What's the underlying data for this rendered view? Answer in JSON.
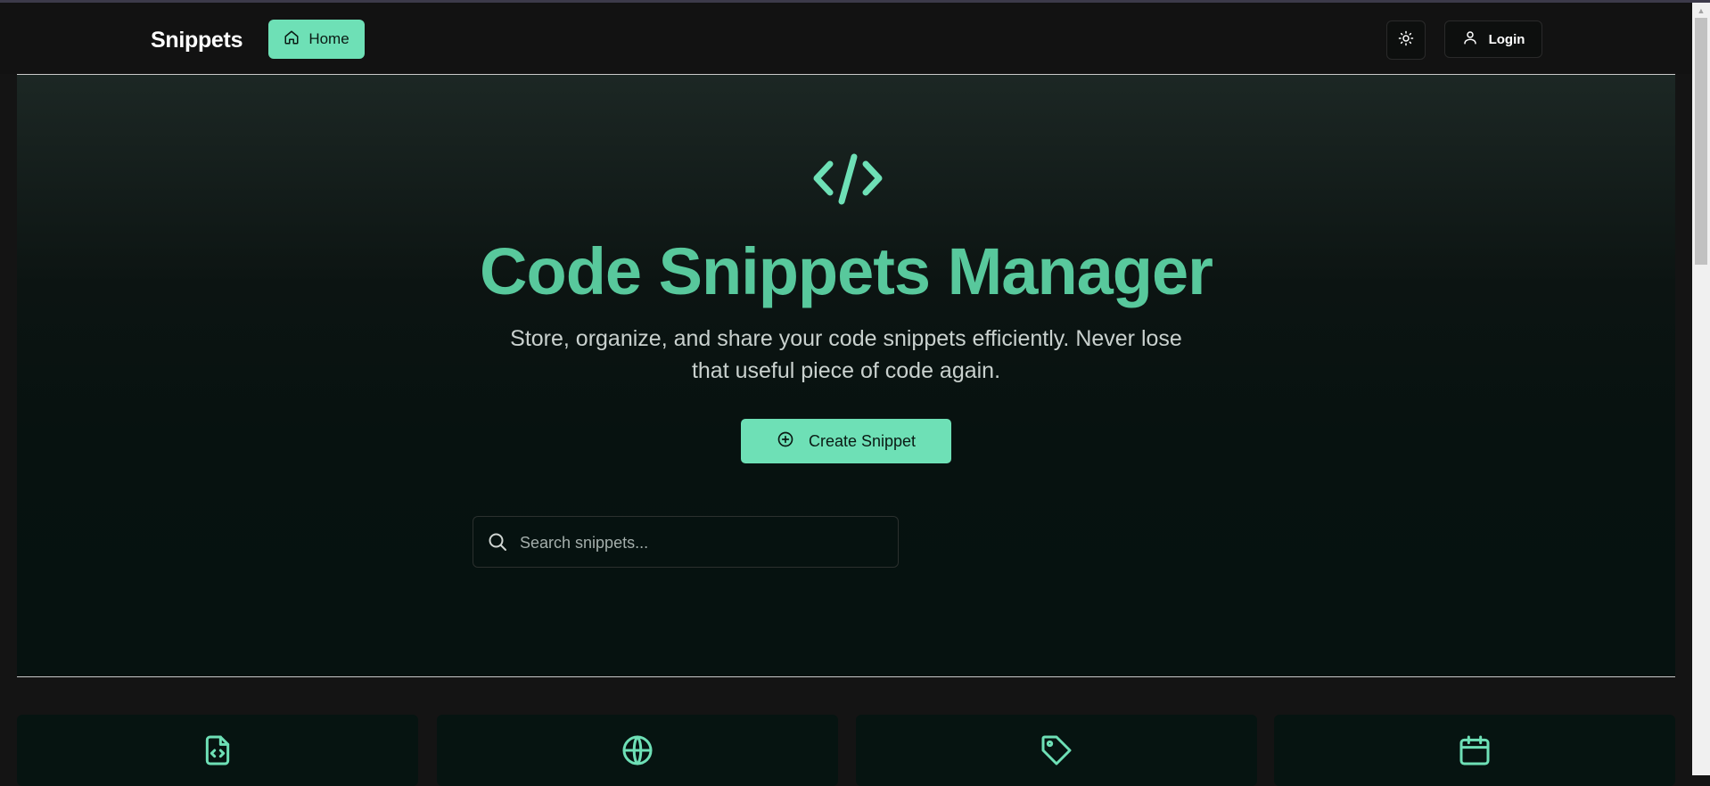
{
  "header": {
    "brand": "Snippets",
    "home_label": "Home",
    "login_label": "Login"
  },
  "hero": {
    "title": "Code Snippets Manager",
    "subtitle": "Store, organize, and share your code snippets efficiently. Never lose that useful piece of code again.",
    "create_label": "Create Snippet"
  },
  "search": {
    "placeholder": "Search snippets..."
  },
  "colors": {
    "accent": "#6ee0b6",
    "title": "#58c89c",
    "background": "#141414"
  },
  "icons": {
    "home": "home-icon",
    "theme": "sun-icon",
    "login": "user-icon",
    "hero": "code-icon",
    "create": "plus-circle-icon",
    "search": "search-icon",
    "cards": [
      "file-code-icon",
      "globe-icon",
      "tag-icon",
      "calendar-icon"
    ]
  }
}
